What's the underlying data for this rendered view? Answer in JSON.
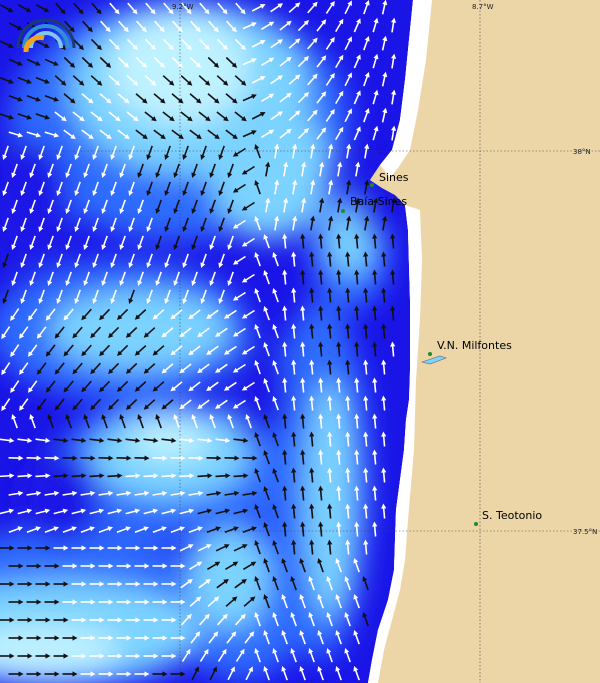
{
  "map": {
    "grid_labels": {
      "lon_left": "9.2°W",
      "lon_right": "8.7°W",
      "lat_top": "38°N",
      "lat_bottom": "37.5°N"
    },
    "places": [
      {
        "name": "Sines"
      },
      {
        "name": "Baía Sines"
      },
      {
        "name": "V.N. Milfontes"
      },
      {
        "name": "S. Teotonio"
      }
    ],
    "colors": {
      "land": "#ecd6a7",
      "deep_sea": "#1a14e6",
      "sea_mid": "#2e6cff",
      "sea_light": "#7bd3ff",
      "sea_pale": "#bff2ff",
      "arrow_dark": "#111111",
      "arrow_light": "#ffffff",
      "place_marker": "#1e8c2c"
    },
    "icons": {
      "logo": "wave-logo-icon"
    }
  }
}
